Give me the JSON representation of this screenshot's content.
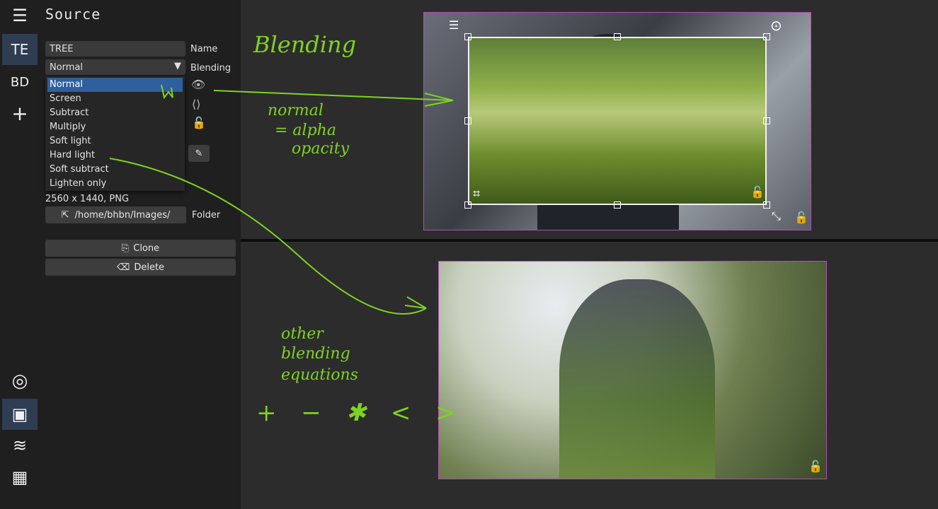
{
  "leftbar": {
    "items": [
      {
        "label": "☰",
        "name": "menu-icon"
      },
      {
        "label": "TE",
        "name": "source-te"
      },
      {
        "label": "BD",
        "name": "source-bd"
      },
      {
        "label": "+",
        "name": "add-source-icon"
      }
    ],
    "bottom": [
      {
        "label": "◎",
        "name": "target-icon"
      },
      {
        "label": "▣",
        "name": "display-icon"
      },
      {
        "label": "≋",
        "name": "layers-icon"
      },
      {
        "label": "▦",
        "name": "checker-icon"
      }
    ]
  },
  "panel": {
    "title": "Source",
    "name_value": "TREE",
    "name_label": "Name",
    "blending_value": "Normal",
    "blending_label": "Blending",
    "blending_options": [
      "Normal",
      "Screen",
      "Subtract",
      "Multiply",
      "Soft light",
      "Hard light",
      "Soft subtract",
      "Lighten only"
    ],
    "info": "2560 x 1440, PNG",
    "folder_path": "/home/bhbn/Images/",
    "folder_label": "Folder",
    "clone_label": "Clone",
    "delete_label": "Delete"
  },
  "annotations": {
    "blending": "Blending",
    "normal": "normal",
    "alpha": "= alpha",
    "opacity": "opacity",
    "other": "other",
    "blending2": "blending",
    "equations": "equations",
    "ops": "+ − ✱ < >"
  },
  "colors": {
    "accent": "#7ed321",
    "frame": "#b04fb3",
    "selected": "#2f5f9c"
  }
}
